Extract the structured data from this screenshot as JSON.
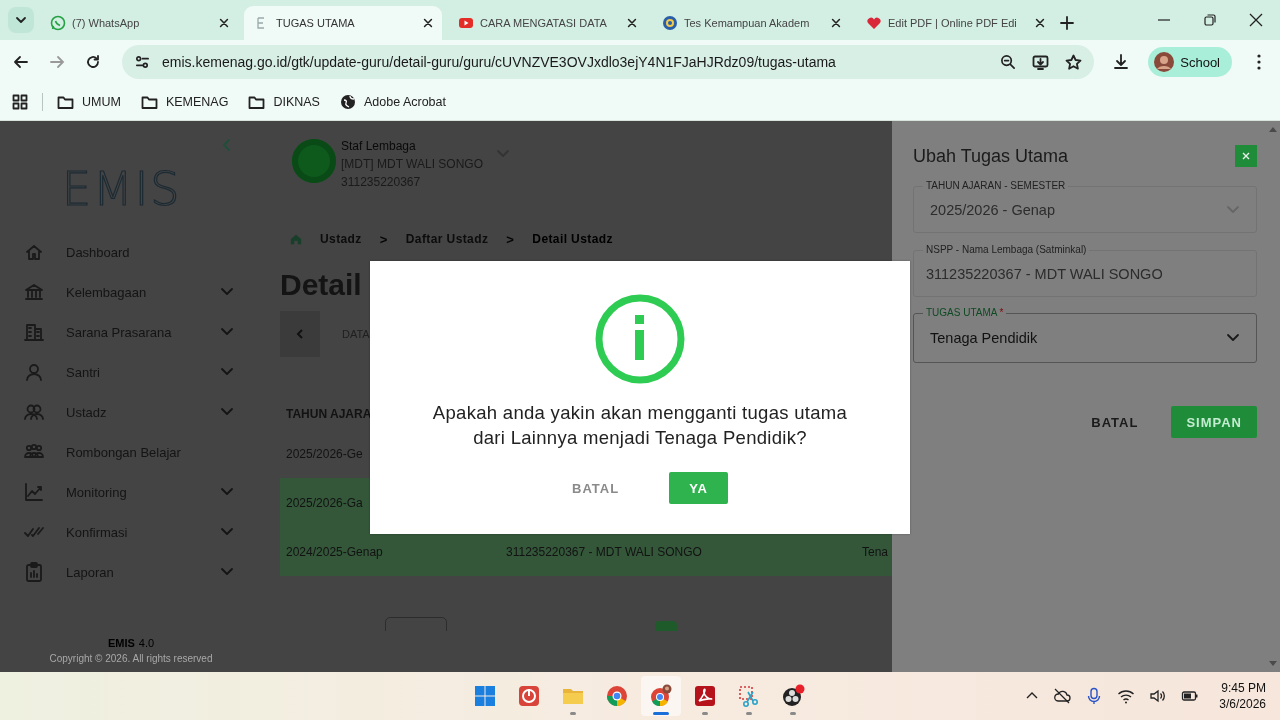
{
  "browser": {
    "tabs": [
      {
        "title": "(7) WhatsApp",
        "kind": "whatsapp",
        "selected": false
      },
      {
        "title": "TUGAS UTAMA",
        "kind": "emis",
        "selected": true
      },
      {
        "title": "CARA MENGATASI DATA",
        "kind": "youtube",
        "selected": false
      },
      {
        "title": "Tes Kemampuan Akadem",
        "kind": "seal",
        "selected": false
      },
      {
        "title": "Edit PDF | Online PDF Edi",
        "kind": "heart",
        "selected": false
      }
    ],
    "url": "emis.kemenag.go.id/gtk/update-guru/detail-guru/guru/cUVNZVE3OVJxdlo3ejY4N1FJaHJRdz09/tugas-utama",
    "profile": "School",
    "bookmarks": [
      {
        "label": "UMUM",
        "kind": "folder"
      },
      {
        "label": "KEMENAG",
        "kind": "folder"
      },
      {
        "label": "DIKNAS",
        "kind": "folder"
      },
      {
        "label": "Adobe Acrobat",
        "kind": "site"
      }
    ]
  },
  "sidebar": {
    "logo": "EMIS",
    "menu": [
      {
        "label": "Dashboard",
        "expandable": false
      },
      {
        "label": "Kelembagaan",
        "expandable": true
      },
      {
        "label": "Sarana Prasarana",
        "expandable": true
      },
      {
        "label": "Santri",
        "expandable": true
      },
      {
        "label": "Ustadz",
        "expandable": true
      },
      {
        "label": "Rombongan Belajar",
        "expandable": false
      },
      {
        "label": "Monitoring",
        "expandable": true
      },
      {
        "label": "Konfirmasi",
        "expandable": true
      },
      {
        "label": "Laporan",
        "expandable": true
      }
    ],
    "footer": {
      "app": "EMIS",
      "version": "4.0",
      "copyright": "Copyright © 2026. All rights reserved"
    }
  },
  "header": {
    "role": "Staf Lembaga",
    "institution": "[MDT] MDT WALI SONGO",
    "nspp": "311235220367"
  },
  "breadcrumb": [
    {
      "label": "Ustadz",
      "current": false
    },
    {
      "separator": ">",
      "label": "Daftar Ustadz",
      "current": false
    },
    {
      "separator": ">",
      "label": "Detail Ustadz",
      "current": true
    }
  ],
  "page_title": "Detail",
  "tab_label": "DATA",
  "table": {
    "columns": [
      "TAHUN AJARA"
    ],
    "rows": [
      {
        "highlighted": false,
        "cells": [
          "2025/2026-Ge"
        ]
      },
      {
        "highlighted": true,
        "cells": [
          "2025/2026-Ga"
        ]
      },
      {
        "highlighted": true,
        "cells": [
          "2024/2025-Genap",
          "311235220367 - MDT WALI SONGO",
          "Tena"
        ]
      }
    ]
  },
  "dialog": {
    "message": "Apakah anda yakin akan mengganti tugas utama dari Lainnya menjadi Tenaga Pendidik?",
    "buttons": [
      {
        "label": "BATAL",
        "kind": "secondary"
      },
      {
        "label": "YA",
        "kind": "primary"
      }
    ]
  },
  "panel": {
    "title": "Ubah Tugas Utama",
    "fields": [
      {
        "label": "TAHUN AJARAN - SEMESTER",
        "value": "2025/2026 - Genap",
        "kind": "select",
        "disabled": true
      },
      {
        "label": "NSPP - Nama Lembaga (Satminkal)",
        "value": "311235220367 - MDT WALI SONGO",
        "kind": "text",
        "disabled": true
      },
      {
        "label": "TUGAS UTAMA",
        "required_mark": "*",
        "value": "Tenaga Pendidik",
        "kind": "select",
        "disabled": false
      }
    ],
    "buttons": [
      {
        "label": "BATAL",
        "kind": "secondary"
      },
      {
        "label": "SIMPAN",
        "kind": "primary"
      }
    ]
  },
  "taskbar": {
    "apps": [
      {
        "kind": "start",
        "running": false,
        "selected": false
      },
      {
        "kind": "office",
        "running": false,
        "selected": false
      },
      {
        "kind": "folder",
        "running": true,
        "selected": false
      },
      {
        "kind": "chrome",
        "running": false,
        "selected": false
      },
      {
        "kind": "chrome-profile",
        "running": true,
        "selected": true
      },
      {
        "kind": "acrobat",
        "running": true,
        "selected": false
      },
      {
        "kind": "snip",
        "running": true,
        "selected": false
      },
      {
        "kind": "obs",
        "running": true,
        "selected": false
      }
    ],
    "clock": {
      "time": "9:45 PM",
      "date": "3/6/2026"
    }
  }
}
